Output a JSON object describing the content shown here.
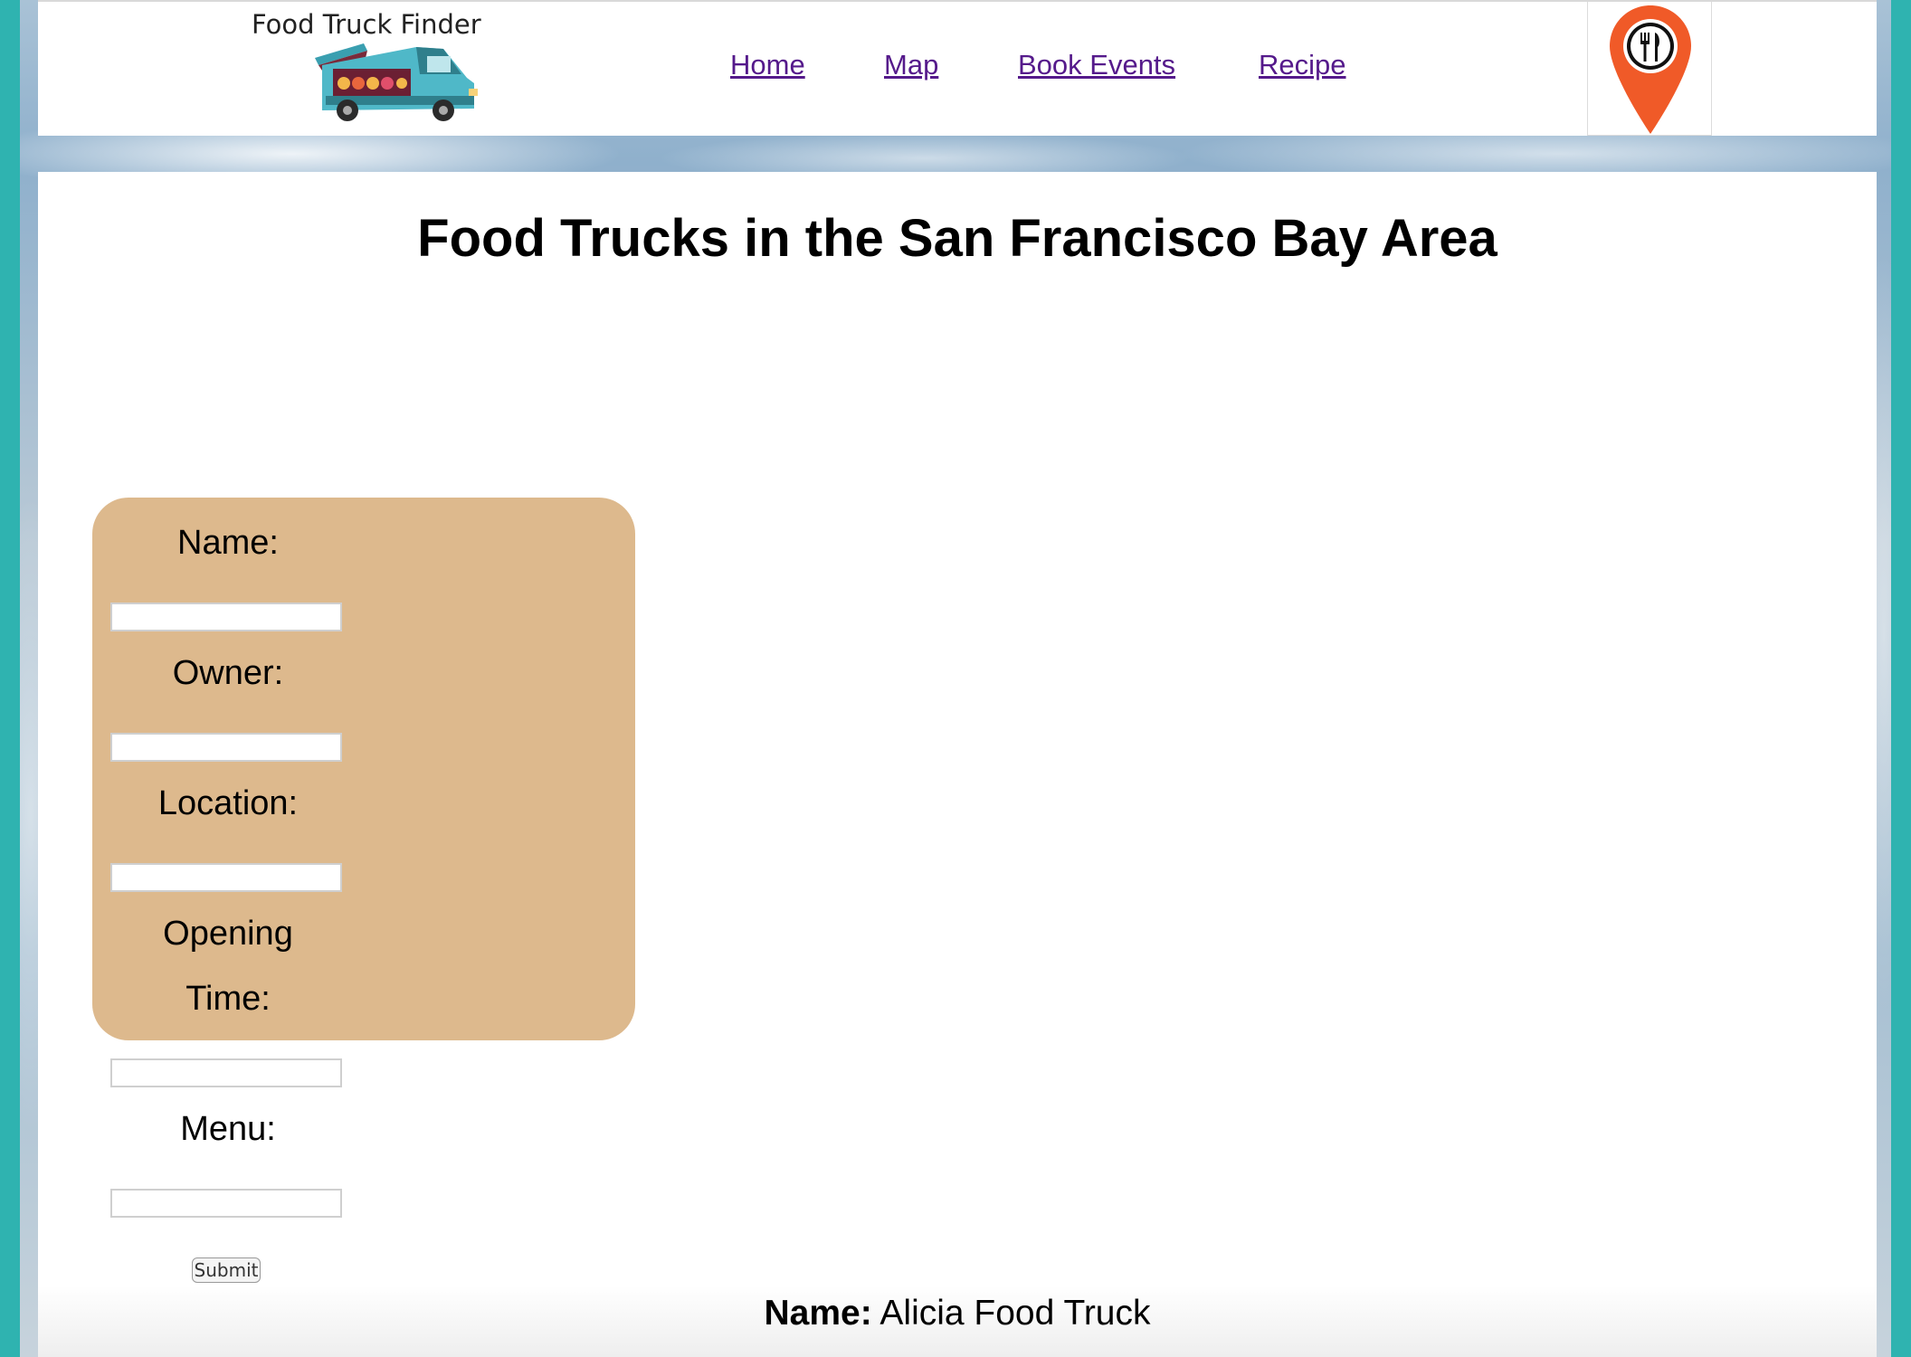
{
  "header": {
    "brand_title": "Food Truck Finder",
    "nav": [
      {
        "label": "Home"
      },
      {
        "label": "Map"
      },
      {
        "label": "Book Events"
      },
      {
        "label": "Recipe"
      }
    ],
    "logo_icon": "food-truck-icon",
    "pin_icon": "map-pin-utensils-icon"
  },
  "main": {
    "title": "Food Trucks in the San Francisco Bay Area",
    "form": {
      "name_label": "Name:",
      "owner_label": "Owner:",
      "location_label": "Location:",
      "opening_label_line1": "Opening",
      "opening_label_line2": "Time:",
      "menu_label": "Menu:",
      "submit_label": "Submit",
      "name_value": "",
      "owner_value": "",
      "location_value": "",
      "opening_value": "",
      "menu_value": ""
    },
    "result": {
      "name_key": "Name:",
      "name_value": "Alicia Food Truck"
    }
  },
  "colors": {
    "link": "#551a8b",
    "form_card": "#ddb98d",
    "pin": "#f05a28",
    "truck_body": "#4fb8c8",
    "page_edge": "#2fb3b0"
  }
}
